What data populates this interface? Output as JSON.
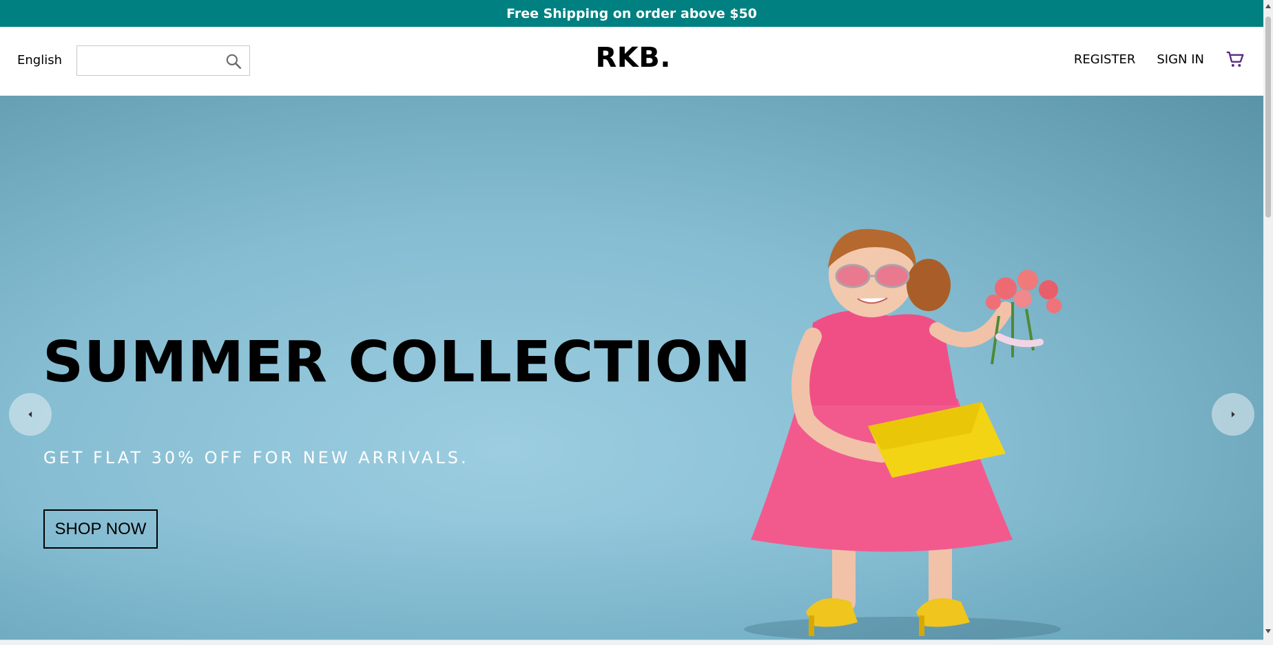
{
  "announcement": {
    "text": "Free Shipping on order above $50",
    "background": "#008080"
  },
  "navbar": {
    "language": "English",
    "search": {
      "value": "",
      "placeholder": "",
      "icon": "search-icon"
    },
    "logo": "RKB.",
    "links": {
      "register": "REGISTER",
      "sign_in": "SIGN IN"
    },
    "cart": {
      "icon": "shopping-cart-icon",
      "color": "#5b2a86"
    }
  },
  "hero": {
    "title": "SUMMER COLLECTION",
    "subtitle": "GET FLAT 30% OFF FOR NEW ARRIVALS.",
    "cta_label": "SHOP NOW",
    "background": "#8fc4d8",
    "prev_icon": "chevron-left-icon",
    "next_icon": "chevron-right-icon",
    "image": "girl-in-pink-dress-photo"
  }
}
